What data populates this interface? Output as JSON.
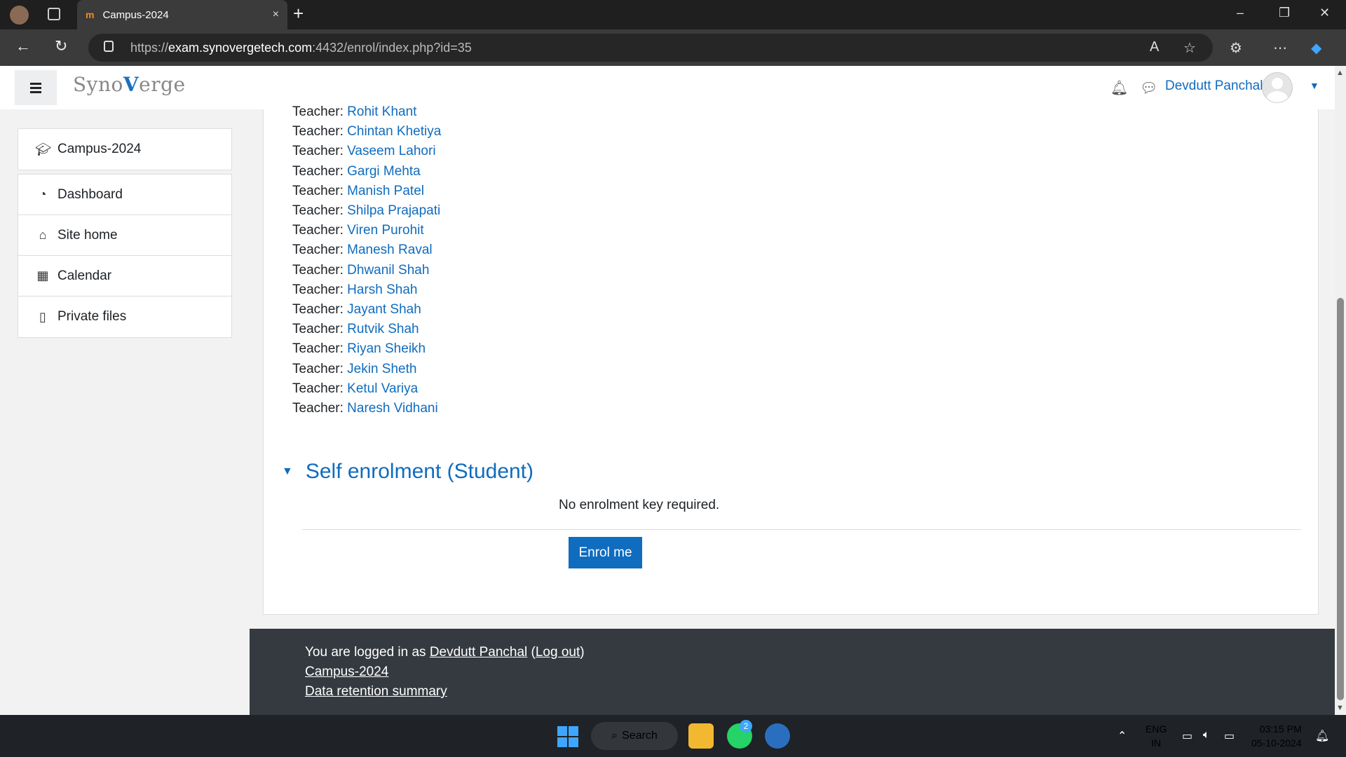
{
  "browser": {
    "tab_title": "Campus-2024",
    "tab_favicon": "m",
    "tab_close": "×",
    "new_tab": "+",
    "url_prefix": "https://",
    "url_host": "exam.synovergetech.com",
    "url_rest": ":4432/enrol/index.php?id=35",
    "window_controls": [
      "–",
      "❐",
      "✕"
    ]
  },
  "header": {
    "logo_text_1": "Syno",
    "logo_text_v": "V",
    "logo_text_2": "erge",
    "user_name": "Devdutt Panchal"
  },
  "drawer": {
    "course": "Campus-2024",
    "items": [
      {
        "label": "Dashboard",
        "icon": "dashboard-icon"
      },
      {
        "label": "Site home",
        "icon": "home-icon"
      },
      {
        "label": "Calendar",
        "icon": "calendar-icon"
      },
      {
        "label": "Private files",
        "icon": "file-icon"
      }
    ]
  },
  "teacher_prefix": "Teacher:",
  "teachers": [
    "Rohit Khant",
    "Chintan Khetiya",
    "Vaseem Lahori",
    "Gargi Mehta",
    "Manish Patel",
    "Shilpa Prajapati",
    "Viren Purohit",
    "Manesh Raval",
    "Dhwanil Shah",
    "Harsh Shah",
    "Jayant Shah",
    "Rutvik Shah",
    "Riyan Sheikh",
    "Jekin Sheth",
    "Ketul Variya",
    "Naresh Vidhani"
  ],
  "enrolment": {
    "section_title": "Self enrolment (Student)",
    "message": "No enrolment key required.",
    "button": "Enrol me"
  },
  "footer": {
    "logged_in_prefix": "You are logged in as ",
    "user": "Devdutt Panchal",
    "logout_open": " (",
    "logout": "Log out",
    "logout_close": ")",
    "course_link": "Campus-2024",
    "retention_link": "Data retention summary"
  },
  "taskbar": {
    "search_label": "Search",
    "whatsapp_badge": "2",
    "lang_1": "ENG",
    "lang_2": "IN",
    "time": "03:15 PM",
    "date": "05-10-2024"
  }
}
